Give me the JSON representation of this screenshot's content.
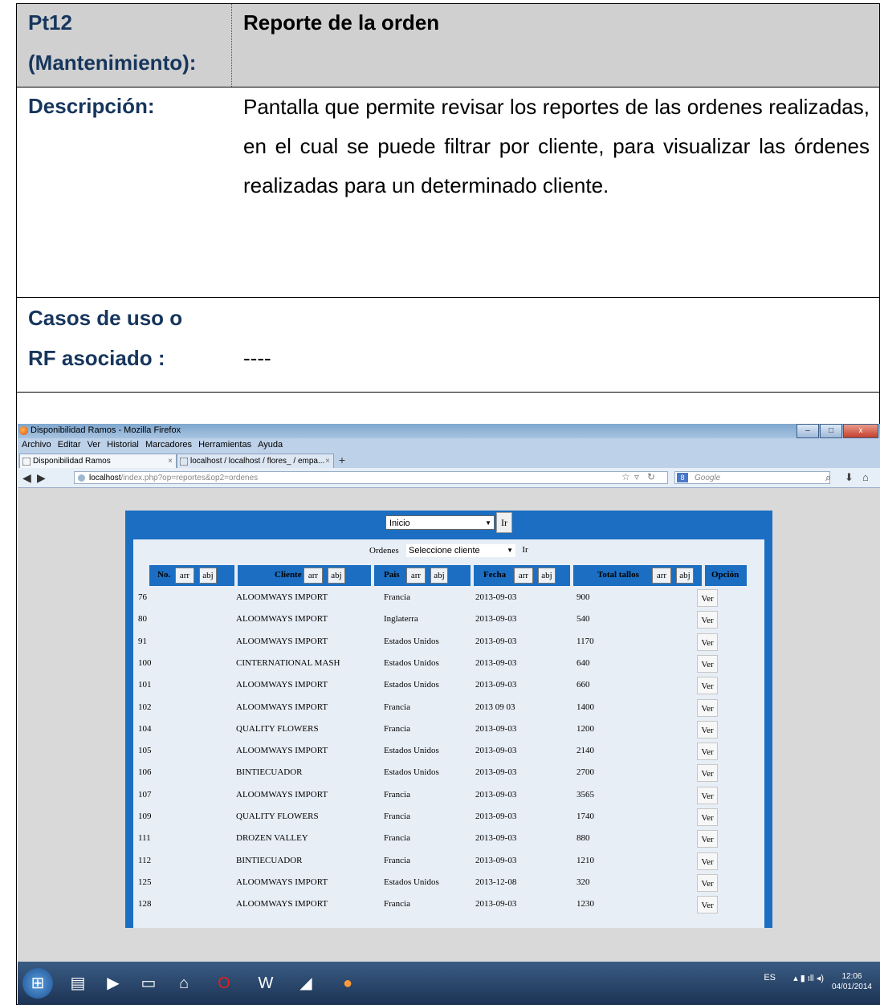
{
  "doc": {
    "header_label": "Pt12 (Mantenimiento):",
    "header_label_line1": "Pt12",
    "header_label_line2": "(Mantenimiento):",
    "header_value": "Reporte de la orden",
    "desc_label": "Descripción:",
    "desc_text": "Pantalla que permite revisar los reportes de las ordenes realizadas, en el cual se puede filtrar por cliente, para visualizar las órdenes realizadas para un determinado cliente.",
    "cases_label_line1": "Casos de uso o",
    "cases_label_line2": "RF asociado :",
    "cases_value": "----"
  },
  "browser": {
    "window_title": "Disponibilidad Ramos - Mozilla Firefox",
    "menu": [
      "Archivo",
      "Editar",
      "Ver",
      "Historial",
      "Marcadores",
      "Herramientas",
      "Ayuda"
    ],
    "tabs": [
      {
        "label": "Disponibilidad Ramos"
      },
      {
        "label": "localhost / localhost / flores_ / empa..."
      }
    ],
    "url_host": "localhost",
    "url_rest": "/index.php?op=reportes&op2=ordenes",
    "search_placeholder": "Google",
    "search_engine": "8"
  },
  "page": {
    "top_select": "Inicio",
    "go_label": "Ir",
    "orders_label": "Ordenes",
    "client_select": "Seleccione cliente",
    "columns": [
      {
        "label": "No."
      },
      {
        "label": "Cliente"
      },
      {
        "label": "Pais"
      },
      {
        "label": "Fecha"
      },
      {
        "label": "Total tallos"
      },
      {
        "label": "Opción"
      }
    ],
    "sort_up": "arr",
    "sort_down": "abj",
    "view_label": "Ver",
    "rows": [
      {
        "no": "76",
        "cliente": "ALOOMWAYS IMPORT",
        "pais": "Francia",
        "fecha": "2013-09-03",
        "total": "900"
      },
      {
        "no": "80",
        "cliente": "ALOOMWAYS IMPORT",
        "pais": "Inglaterra",
        "fecha": "2013-09-03",
        "total": "540"
      },
      {
        "no": "91",
        "cliente": "ALOOMWAYS IMPORT",
        "pais": "Estados Unidos",
        "fecha": "2013-09-03",
        "total": "1170"
      },
      {
        "no": "100",
        "cliente": "CINTERNATIONAL MASH",
        "pais": "Estados Unidos",
        "fecha": "2013-09-03",
        "total": "640"
      },
      {
        "no": "101",
        "cliente": "ALOOMWAYS IMPORT",
        "pais": "Estados Unidos",
        "fecha": "2013-09-03",
        "total": "660"
      },
      {
        "no": "102",
        "cliente": "ALOOMWAYS IMPORT",
        "pais": "Francia",
        "fecha": "2013 09 03",
        "total": "1400"
      },
      {
        "no": "104",
        "cliente": "QUALITY FLOWERS",
        "pais": "Francia",
        "fecha": "2013-09-03",
        "total": "1200"
      },
      {
        "no": "105",
        "cliente": "ALOOMWAYS IMPORT",
        "pais": "Estados Unidos",
        "fecha": "2013-09-03",
        "total": "2140"
      },
      {
        "no": "106",
        "cliente": "BINTIECUADOR",
        "pais": "Estados Unidos",
        "fecha": "2013-09-03",
        "total": "2700"
      },
      {
        "no": "107",
        "cliente": "ALOOMWAYS IMPORT",
        "pais": "Francia",
        "fecha": "2013-09-03",
        "total": "3565"
      },
      {
        "no": "109",
        "cliente": "QUALITY FLOWERS",
        "pais": "Francia",
        "fecha": "2013-09-03",
        "total": "1740"
      },
      {
        "no": "111",
        "cliente": "DROZEN VALLEY",
        "pais": "Francia",
        "fecha": "2013-09-03",
        "total": "880"
      },
      {
        "no": "112",
        "cliente": "BINTIECUADOR",
        "pais": "Francia",
        "fecha": "2013-09-03",
        "total": "1210"
      },
      {
        "no": "125",
        "cliente": "ALOOMWAYS IMPORT",
        "pais": "Estados Unidos",
        "fecha": "2013-12-08",
        "total": "320"
      },
      {
        "no": "128",
        "cliente": "ALOOMWAYS IMPORT",
        "pais": "Francia",
        "fecha": "2013-09-03",
        "total": "1230"
      }
    ]
  },
  "taskbar": {
    "lang": "ES",
    "time": "12:06",
    "date": "04/01/2014",
    "icons": [
      "start-orb-icon",
      "file-explorer-icon",
      "media-player-icon",
      "network-icon",
      "hp-icon",
      "opera-icon",
      "word-icon",
      "app-icon",
      "firefox-icon"
    ]
  },
  "colors": {
    "doc_header_bg": "#d0d0d0",
    "label_color": "#17365d",
    "panel_blue": "#1b6ec2"
  }
}
